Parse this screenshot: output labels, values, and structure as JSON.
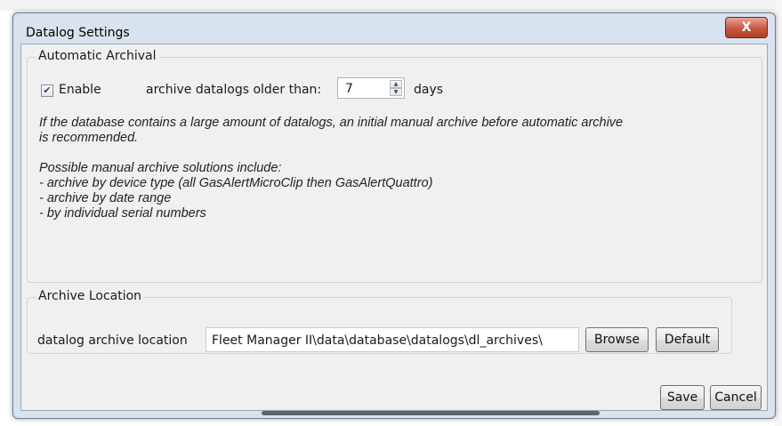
{
  "window": {
    "title": "Datalog Settings",
    "close_glyph": "X"
  },
  "automatic_archival": {
    "legend": "Automatic Archival",
    "enable_checked": true,
    "enable_label": "Enable",
    "older_than_label": "archive datalogs older than:",
    "days_value": "7",
    "days_label": "days",
    "info_lines": [
      "If the database contains a large amount of datalogs, an initial manual archive before automatic archive",
      " is recommended.",
      "Possible manual archive solutions include:",
      "- archive by device type (all GasAlertMicroClip then GasAlertQuattro)",
      "- archive by date range",
      "- by individual serial numbers"
    ]
  },
  "archive_location": {
    "legend": "Archive Location",
    "label": "datalog archive location",
    "value": "Fleet Manager II\\data\\database\\datalogs\\dl_archives\\",
    "browse_label": "Browse",
    "default_label": "Default"
  },
  "footer": {
    "save_label": "Save",
    "cancel_label": "Cancel"
  },
  "icons": {
    "close": "close-icon",
    "checkbox": "check-icon",
    "spin_up": "chevron-up-icon",
    "spin_down": "chevron-down-icon"
  },
  "colors": {
    "close_button": "#c9563e",
    "window_frame": "#d8e3ef",
    "client_bg": "#f0f0f0"
  }
}
